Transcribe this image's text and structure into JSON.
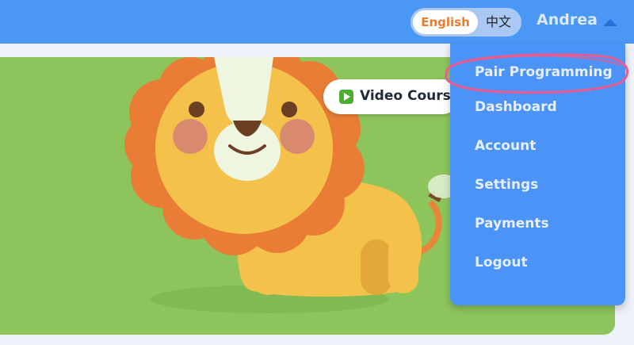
{
  "header": {
    "language_toggle": {
      "options": [
        "English",
        "中文"
      ],
      "selected": "English"
    },
    "user": {
      "name": "Andrea"
    }
  },
  "hero": {
    "video_button": {
      "label": "Video Courses",
      "icon": "play-icon"
    }
  },
  "user_menu": {
    "items": [
      "Pair Programming",
      "Dashboard",
      "Account",
      "Settings",
      "Payments",
      "Logout"
    ],
    "highlighted": "Pair Programming"
  },
  "colors": {
    "topbar": "#4b97f5",
    "menu": "#4b93f7",
    "hero": "#8dc55c",
    "accent_orange": "#f07a2a",
    "highlight": "#ee5a8d"
  }
}
